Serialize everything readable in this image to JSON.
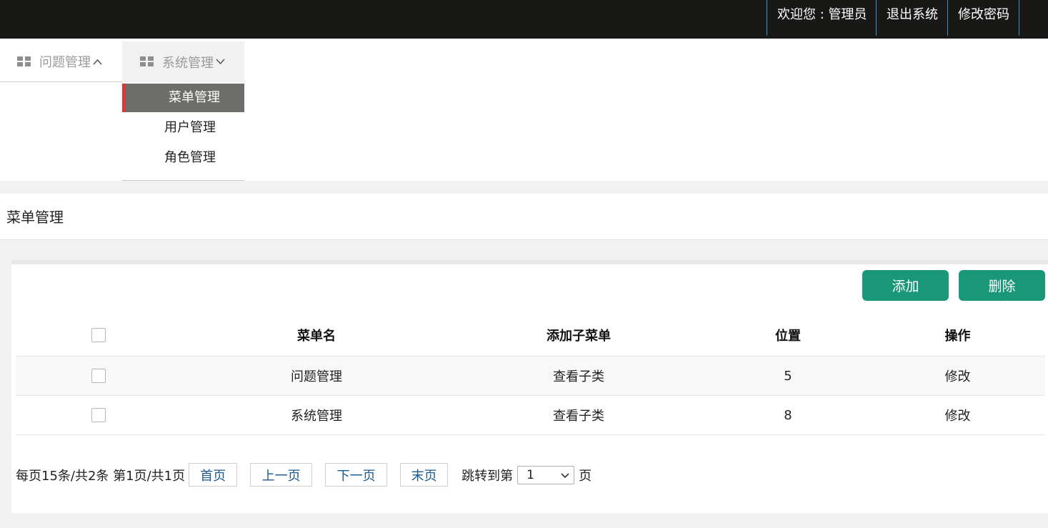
{
  "header": {
    "welcome": "欢迎您 : 管理员",
    "logout": "退出系统",
    "change_password": "修改密码"
  },
  "menus": [
    {
      "label": "问题管理",
      "icon": "windows-grid-icon",
      "state": "collapsed",
      "chevron": "chevron-up-icon"
    },
    {
      "label": "系统管理",
      "icon": "windows-grid-icon",
      "state": "expanded",
      "chevron": "chevron-down-icon"
    }
  ],
  "submenu": {
    "items": [
      {
        "label": "菜单管理",
        "active": true
      },
      {
        "label": "用户管理",
        "active": false
      },
      {
        "label": "角色管理",
        "active": false
      }
    ]
  },
  "page": {
    "title": "菜单管理"
  },
  "toolbar": {
    "add_label": "添加",
    "delete_label": "删除"
  },
  "table": {
    "headers": [
      "菜单名",
      "添加子菜单",
      "位置",
      "操作"
    ],
    "rows": [
      {
        "name": "问题管理",
        "submenu_link": "查看子类",
        "position": "5",
        "action": "修改"
      },
      {
        "name": "系统管理",
        "submenu_link": "查看子类",
        "position": "8",
        "action": "修改"
      }
    ]
  },
  "pagination": {
    "summary": "每页15条/共2条 第1页/共1页",
    "first": "首页",
    "prev": "上一页",
    "next": "下一页",
    "last": "末页",
    "jump_label": "跳转到第",
    "page_select_value": "1",
    "page_unit": "页"
  },
  "colors": {
    "topbar_bg": "#181816",
    "topbar_divider": "#3d8fc4",
    "active_submenu_bg": "#6d6d69",
    "active_submenu_marker": "#d9393a",
    "button_bg": "#199778",
    "pager_link": "#1c5a8c"
  }
}
